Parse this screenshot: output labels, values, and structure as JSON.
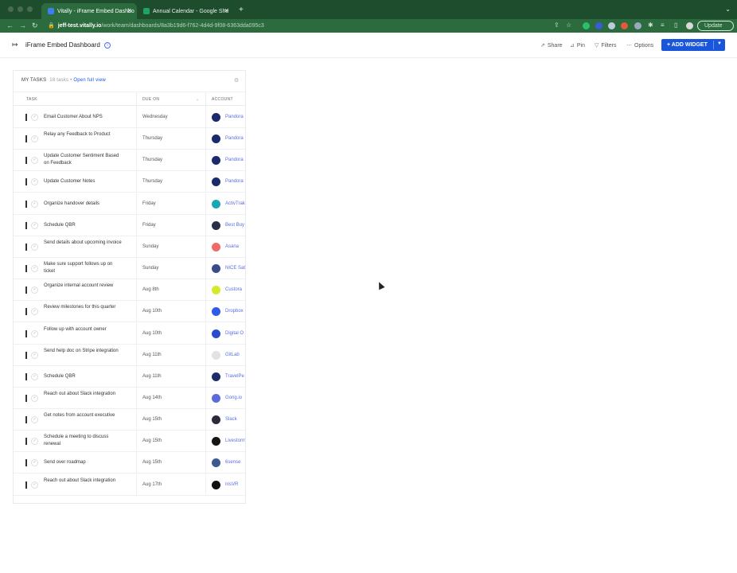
{
  "browser": {
    "tabs": [
      {
        "title": "Vitally - iFrame Embed Dashbo",
        "active": true,
        "favicon_color": "#3f7df0"
      },
      {
        "title": "Annual Calendar - Google She",
        "active": false,
        "favicon_color": "#1fa463"
      }
    ],
    "new_tab_symbol": "+",
    "tab_menu_symbol": "⌄",
    "url_host": "jeff-test.vitally.io",
    "url_path": "/work/team/dashboards/8a3b19d6-f762-4d4d-9f08-6363dda095c3",
    "update_label": "Update",
    "colors": {
      "chrome": "#1e4d2e",
      "toolbar": "#2b6b3e"
    }
  },
  "header": {
    "title": "iFrame Embed Dashboard",
    "share_label": "Share",
    "pin_label": "Pin",
    "filters_label": "Filters",
    "options_label": "Options",
    "add_widget_label": "+ ADD WIDGET",
    "accent": "#1a56db"
  },
  "widget": {
    "title": "MY TASKS",
    "count": "18 tasks •",
    "link": "Open full view",
    "columns": {
      "task": "TASK",
      "due": "DUE ON",
      "account": "ACCOUNT"
    },
    "rows": [
      {
        "task": "Email Customer About NPS",
        "due": "Wednesday",
        "account": "Pandora",
        "logo": "pandora",
        "logo_color": "#1a2a6c"
      },
      {
        "task": "Relay any Feedback to Product",
        "due": "Thursday",
        "account": "Pandora",
        "logo": "pandora",
        "logo_color": "#1a2a6c"
      },
      {
        "task": "Update Customer Sentiment Based on Feedback",
        "due": "Thursday",
        "account": "Pandora",
        "logo": "pandora",
        "logo_color": "#1a2a6c"
      },
      {
        "task": "Update Customer Notes",
        "due": "Thursday",
        "account": "Pandora",
        "logo": "pandora",
        "logo_color": "#1a2a6c"
      },
      {
        "task": "Organize handover details",
        "due": "Friday",
        "account": "ActivTrak",
        "logo": "activtrak",
        "logo_color": "#1aa6b7"
      },
      {
        "task": "Schedule QBR",
        "due": "Friday",
        "account": "Best Buy",
        "logo": "bestbuy",
        "logo_color": "#2a2f45"
      },
      {
        "task": "Send details about upcoming invoice",
        "due": "Sunday",
        "account": "Asana",
        "logo": "asana",
        "logo_color": "#f06a6a"
      },
      {
        "task": "Make sure support follows up on ticket",
        "due": "Sunday",
        "account": "NICE Sat",
        "logo": "nice",
        "logo_color": "#3a4b8c"
      },
      {
        "task": "Organize internal account review",
        "due": "Aug 8th",
        "account": "Custora",
        "logo": "custora",
        "logo_color": "#d7e92c"
      },
      {
        "task": "Review milestones for this quarter",
        "due": "Aug 10th",
        "account": "Dropbox",
        "logo": "dropbox",
        "logo_color": "#2f5bea"
      },
      {
        "task": "Follow up with account owner",
        "due": "Aug 10th",
        "account": "Digital O",
        "logo": "digital",
        "logo_color": "#2a4ad1"
      },
      {
        "task": "Send help doc on Stripe integration",
        "due": "Aug 11th",
        "account": "GitLab",
        "logo": "gitlab",
        "logo_color": "#e2e2e2"
      },
      {
        "task": "Schedule QBR",
        "due": "Aug 11th",
        "account": "TravelPe",
        "logo": "travelperk",
        "logo_color": "#1d2b6b"
      },
      {
        "task": "Reach out about Slack integration",
        "due": "Aug 14th",
        "account": "Gong.io",
        "logo": "gong",
        "logo_color": "#5b6bd8"
      },
      {
        "task": "Get notes from account executive",
        "due": "Aug 15th",
        "account": "Slack",
        "logo": "slack",
        "logo_color": "#2a2a3a"
      },
      {
        "task": "Schedule a meeting to discuss renewal",
        "due": "Aug 15th",
        "account": "Livestorm",
        "logo": "livestorm",
        "logo_color": "#151515"
      },
      {
        "task": "Send over roadmap",
        "due": "Aug 15th",
        "account": "6sense",
        "logo": "6sense",
        "logo_color": "#3b5a8e"
      },
      {
        "task": "Reach out about Slack integration",
        "due": "Aug 17th",
        "account": "IrisVR",
        "logo": "irisvr",
        "logo_color": "#111111"
      }
    ]
  }
}
